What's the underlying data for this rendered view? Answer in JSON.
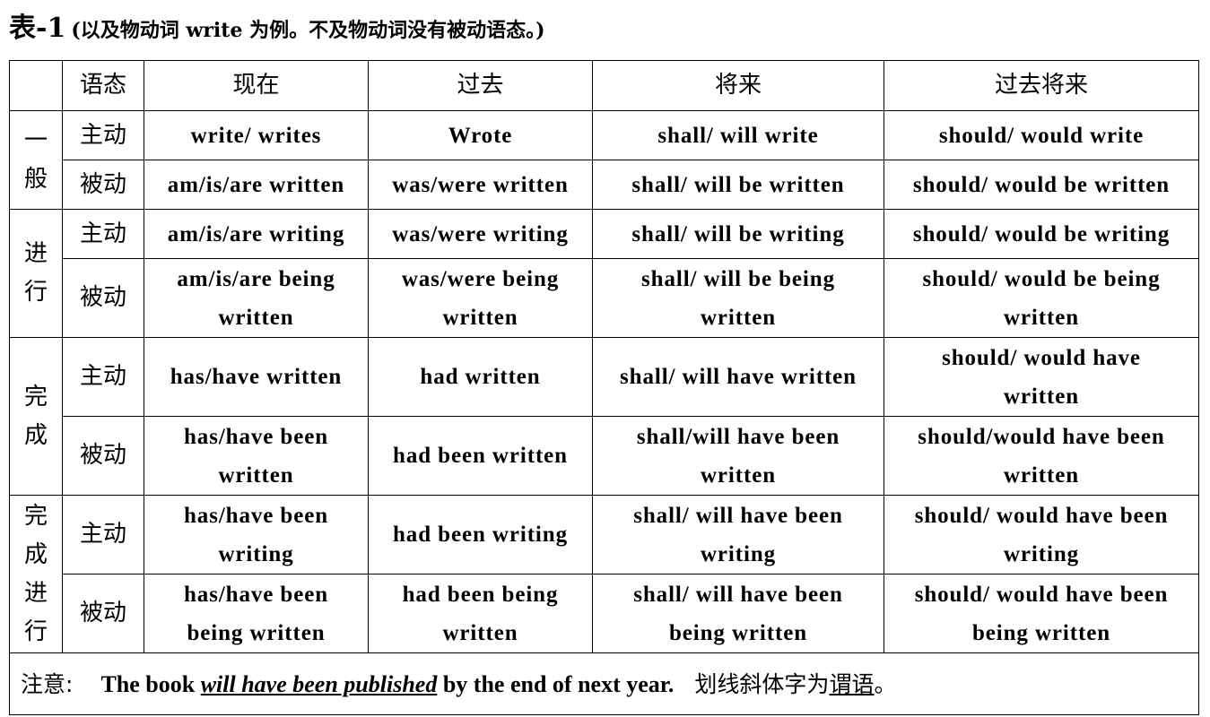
{
  "caption": {
    "label": "表-1",
    "note": "(以及物动词 write  为例。不及物动词没有被动语态。)"
  },
  "header": {
    "corner": "",
    "voice": "语态",
    "columns": [
      "现在",
      "过去",
      "将来",
      "过去将来"
    ]
  },
  "groups": [
    {
      "category": "一般",
      "rows": [
        {
          "voice": "主动",
          "cells": [
            [
              "write/ writes"
            ],
            [
              "Wrote"
            ],
            [
              "shall/ will write"
            ],
            [
              "should/ would write"
            ]
          ]
        },
        {
          "voice": "被动",
          "cells": [
            [
              "am/is/are written"
            ],
            [
              "was/were written"
            ],
            [
              "shall/ will be written"
            ],
            [
              "should/ would be written"
            ]
          ]
        }
      ]
    },
    {
      "category": "进行",
      "rows": [
        {
          "voice": "主动",
          "cells": [
            [
              "am/is/are writing"
            ],
            [
              "was/were writing"
            ],
            [
              "shall/ will be writing"
            ],
            [
              "should/ would be writing"
            ]
          ]
        },
        {
          "voice": "被动",
          "cells": [
            [
              "am/is/are being",
              "written"
            ],
            [
              "was/were being",
              "written"
            ],
            [
              "shall/ will be being",
              "written"
            ],
            [
              "should/ would be being",
              "written"
            ]
          ]
        }
      ]
    },
    {
      "category": "完成",
      "rows": [
        {
          "voice": "主动",
          "cells": [
            [
              "has/have written"
            ],
            [
              "had written"
            ],
            [
              "shall/ will have written"
            ],
            [
              "should/ would have",
              "written"
            ]
          ]
        },
        {
          "voice": "被动",
          "cells": [
            [
              "has/have been",
              "written"
            ],
            [
              "had been written"
            ],
            [
              "shall/will have been",
              "written"
            ],
            [
              "should/would have been",
              "written"
            ]
          ]
        }
      ]
    },
    {
      "category": "完成进行",
      "rows": [
        {
          "voice": "主动",
          "cells": [
            [
              "has/have been",
              "writing"
            ],
            [
              "had been writing"
            ],
            [
              "shall/ will have been",
              "writing"
            ],
            [
              "should/ would have been",
              "writing"
            ]
          ]
        },
        {
          "voice": "被动",
          "cells": [
            [
              "has/have been",
              "being written"
            ],
            [
              "had been being",
              "written"
            ],
            [
              "shall/ will have been",
              "being written"
            ],
            [
              "should/ would have been",
              "being written"
            ]
          ]
        }
      ]
    }
  ],
  "note": {
    "label": "注意:",
    "sentence_start": "The book ",
    "sentence_emphasis": "will have been published",
    "sentence_end": " by the end of next year.",
    "explain_prefix": "划线斜体字为",
    "explain_term": "谓语",
    "explain_suffix": "。"
  }
}
